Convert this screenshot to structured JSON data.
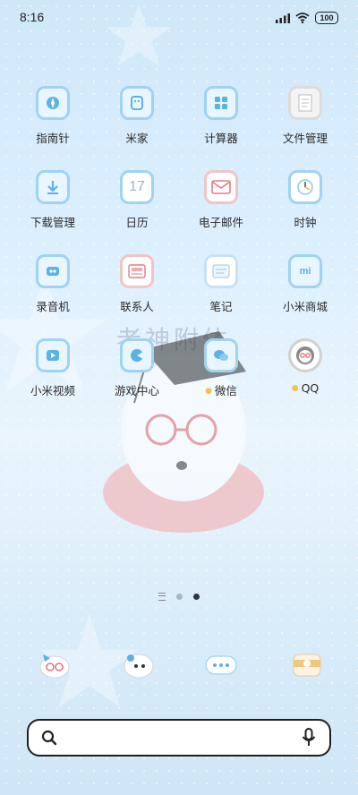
{
  "status_bar": {
    "time": "8:16",
    "battery": "100",
    "icons": [
      "signal-icon",
      "wifi-icon",
      "battery-icon"
    ]
  },
  "apps": [
    {
      "label": "指南针",
      "icon": "compass-icon"
    },
    {
      "label": "米家",
      "icon": "mijia-icon"
    },
    {
      "label": "计算器",
      "icon": "calculator-icon"
    },
    {
      "label": "文件管理",
      "icon": "file-manager-icon"
    },
    {
      "label": "下载管理",
      "icon": "download-icon"
    },
    {
      "label": "日历",
      "icon": "calendar-icon",
      "badge_text": "17"
    },
    {
      "label": "电子邮件",
      "icon": "email-icon"
    },
    {
      "label": "时钟",
      "icon": "clock-icon"
    },
    {
      "label": "录音机",
      "icon": "recorder-icon"
    },
    {
      "label": "联系人",
      "icon": "contacts-icon"
    },
    {
      "label": "笔记",
      "icon": "notes-icon"
    },
    {
      "label": "小米商城",
      "icon": "mi-store-icon"
    },
    {
      "label": "小米视频",
      "icon": "mi-video-icon"
    },
    {
      "label": "游戏中心",
      "icon": "game-center-icon"
    },
    {
      "label": "微信",
      "icon": "wechat-icon",
      "new_dot": true
    },
    {
      "label": "QQ",
      "icon": "qq-icon",
      "new_dot": true
    }
  ],
  "wallpaper": {
    "watermark_text": "老神附体",
    "accent": "#9fd3f3",
    "background": "#dcefff"
  },
  "pager": {
    "pages": 2,
    "active": 2
  },
  "dock": [
    "hello-kitty-phone-icon",
    "hello-kitty-camera-icon",
    "hello-kitty-messages-icon",
    "hello-kitty-browser-icon"
  ],
  "search": {
    "placeholder": ""
  }
}
